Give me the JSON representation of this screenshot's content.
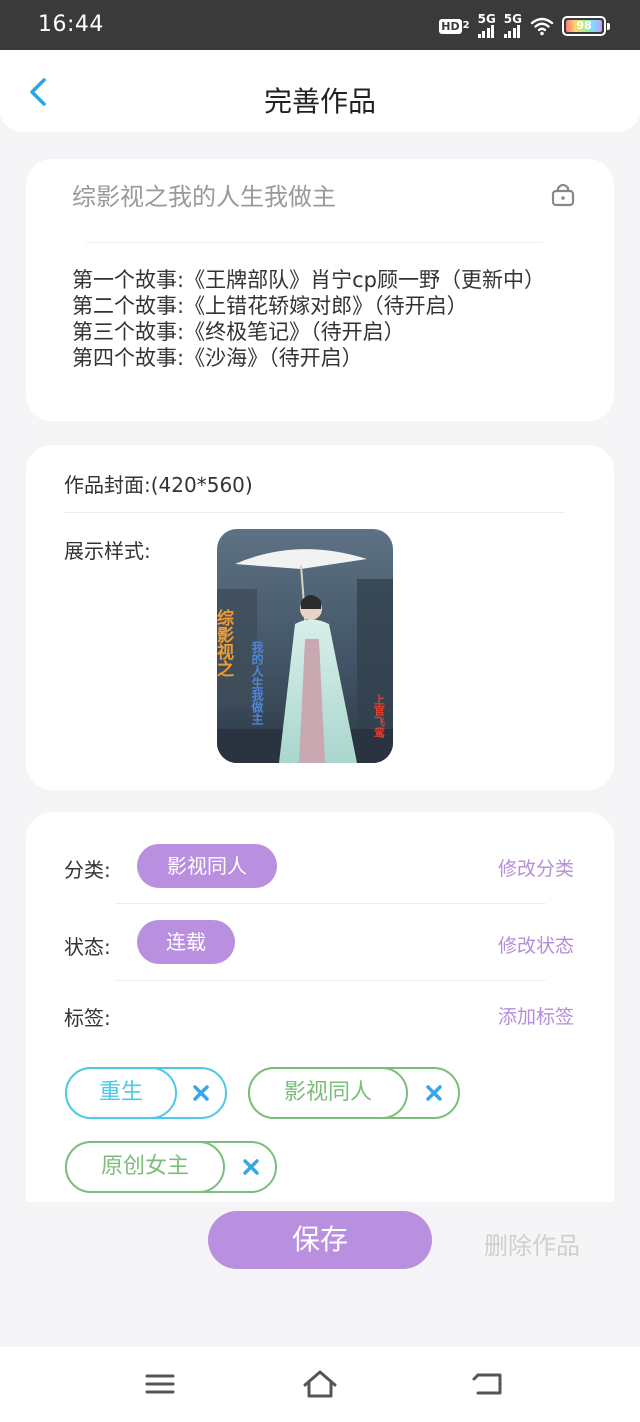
{
  "status_bar": {
    "time": "16:44",
    "hd": "HD",
    "hd_sub": "2",
    "net1": "5G",
    "net2": "5G",
    "battery": "98"
  },
  "header": {
    "title": "完善作品",
    "back_icon": "chevron-left-icon"
  },
  "work": {
    "title": "综影视之我的人生我做主",
    "description": "第一个故事:《王牌部队》肖宁cp顾一野（更新中）\n第二个故事:《上错花轿嫁对郎》（待开启）\n第三个故事:《终极笔记》（待开启）\n第四个故事:《沙海》（待开启）"
  },
  "cover": {
    "label": "作品封面:",
    "size": "(420*560)",
    "style_label": "展示样式:",
    "overlay_text_1": "综影视之",
    "overlay_text_2": "我的人生我做主",
    "overlay_text_3": "上官飞鸾"
  },
  "meta": {
    "category_label": "分类:",
    "category_value": "影视同人",
    "category_action": "修改分类",
    "status_label": "状态:",
    "status_value": "连载",
    "status_action": "修改状态",
    "tags_label": "标签:",
    "tags_action": "添加标签",
    "tags": [
      {
        "label": "重生",
        "color": "#4cc9e4"
      },
      {
        "label": "影视同人",
        "color": "#7cbd7c"
      },
      {
        "label": "原创女主",
        "color": "#7cbd7c"
      }
    ]
  },
  "actions": {
    "save": "保存",
    "delete": "删除作品"
  },
  "colors": {
    "accent": "#b990e0",
    "link": "#b58ed8",
    "back_arrow": "#2ba5e8"
  }
}
